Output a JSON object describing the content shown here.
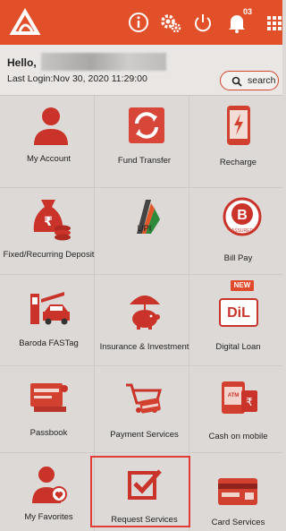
{
  "topbar": {
    "notifications_count": "03",
    "icons": [
      "bank-logo-icon",
      "info-icon",
      "gears-icon",
      "power-icon",
      "bell-icon",
      "grid-menu-icon"
    ],
    "bg_color": "#e2502a"
  },
  "header": {
    "greeting": "Hello,",
    "last_login": "Last Login:Nov 30, 2020 11:29:00",
    "search_label": "search"
  },
  "services": [
    {
      "label": "My Account",
      "icon": "account-icon"
    },
    {
      "label": "Fund Transfer",
      "icon": "fund-transfer-icon"
    },
    {
      "label": "Recharge",
      "icon": "recharge-icon"
    },
    {
      "label": "Fixed/Recurring Deposit",
      "icon": "deposit-icon"
    },
    {
      "label": "UPI",
      "icon": "upi-icon"
    },
    {
      "label": "Bill Pay",
      "icon": "bill-pay-icon"
    },
    {
      "label": "Baroda FASTag",
      "icon": "fastag-icon"
    },
    {
      "label": "Insurance & Investment",
      "icon": "insurance-icon"
    },
    {
      "label": "Digital Loan",
      "icon": "digital-loan-icon"
    },
    {
      "label": "Passbook",
      "icon": "passbook-icon"
    },
    {
      "label": "Payment Services",
      "icon": "payment-services-icon"
    },
    {
      "label": "Cash on mobile",
      "icon": "cash-on-mobile-icon"
    },
    {
      "label": "My Favorites",
      "icon": "favorites-icon"
    },
    {
      "label": "Request Services",
      "icon": "request-services-icon"
    },
    {
      "label": "Card Services",
      "icon": "card-services-icon"
    }
  ],
  "new_badge": "NEW",
  "bill_pay_badge": {
    "letter": "B",
    "text": "ASSURED"
  },
  "digital_loan_logo": "DiL",
  "atm_text": "ATM",
  "rupee": "₹",
  "accent_color": "#d0462a"
}
